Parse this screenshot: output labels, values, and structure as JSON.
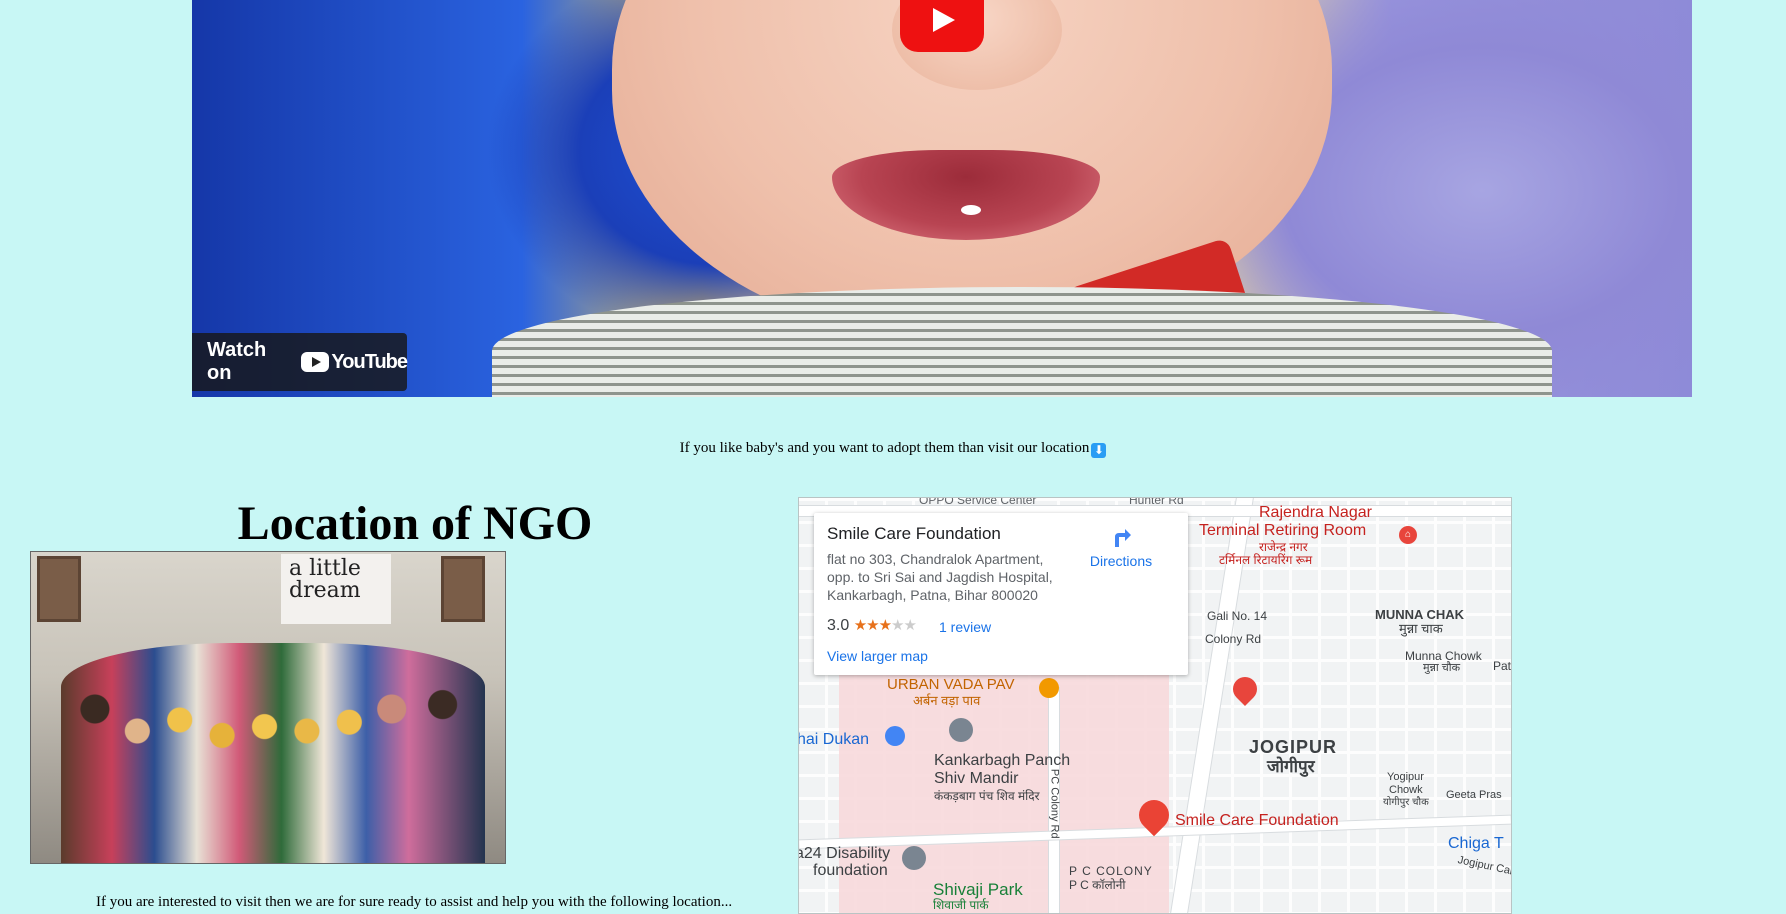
{
  "video": {
    "watch_text": "Watch on",
    "youtube_word": "YouTube",
    "play_icon": "youtube-play-icon"
  },
  "adopt_text": "If you like baby's and you want to adopt them than visit our location",
  "adopt_icon": "down-arrow-icon",
  "location_title": "Location of NGO",
  "photo": {
    "banner_text": "a little dream"
  },
  "visit_text": "If you are interested to visit then we are for sure ready to assist and help you with the following location...",
  "map": {
    "card": {
      "title": "Smile Care Foundation",
      "address": "flat no 303, Chandralok Apartment, opp. to Sri Sai and Jagdish Hospital, Kankarbagh, Patna, Bihar 800020",
      "rating": "3.0",
      "stars_on": "★★★",
      "stars_off": "★★",
      "reviews": "1 review",
      "directions": "Directions",
      "larger_map": "View larger map"
    },
    "labels": {
      "rajendra_nagar": "Rajendra Nagar",
      "terminal": "Terminal Retiring Room",
      "rajendra_hindi": "राजेन्द्र नगर",
      "terminal_hindi": "टर्मिनल रिटायरिंग रूम",
      "hunter_rd": "Hunter Rd",
      "service_center": "OPPO Service Center",
      "gali": "Gali No. 14",
      "munna_chak": "MUNNA CHAK",
      "munna_chak_hindi": "मुन्ना चाक",
      "munna_chowk": "Munna Chowk",
      "munna_chowk_hindi": "मुन्ना चौक",
      "colony_rd": "Colony Rd",
      "urban_vada": "URBAN VADA PAV",
      "urban_vada_hindi": "अर्बन वड़ा पाव",
      "dukan": "hai Dukan",
      "kankarbagh": "Kankarbagh Panch",
      "shiv_mandir": "Shiv Mandir",
      "shiv_hindi": "कंकड़बाग पंच शिव मंदिर",
      "pc_colony_rd": "PC Colony Rd",
      "jogipur": "JOGIPUR",
      "jogipur_hindi": "जोगीपुर",
      "yogipur": "Yogipur",
      "chowk": "Chowk",
      "yogipur_hindi": "योगीपुर चौक",
      "geeta": "Geeta Pras",
      "smile_pin": "Smile Care Foundation",
      "disability": "a24 Disability",
      "foundation": "foundation",
      "pc_colony": "P C COLONY",
      "pc_colony_hindi": "P C कॉलोनी",
      "chiga": "Chiga T",
      "jogipur_canal": "Jogipur Canal",
      "shivaji_park": "Shivaji Park",
      "shivaji_hindi": "शिवाजी पार्क",
      "pat": "Pat"
    },
    "colors": {
      "link": "#1a73e8",
      "poi_red": "#e8453c",
      "label_pink": "#c5221f"
    }
  }
}
